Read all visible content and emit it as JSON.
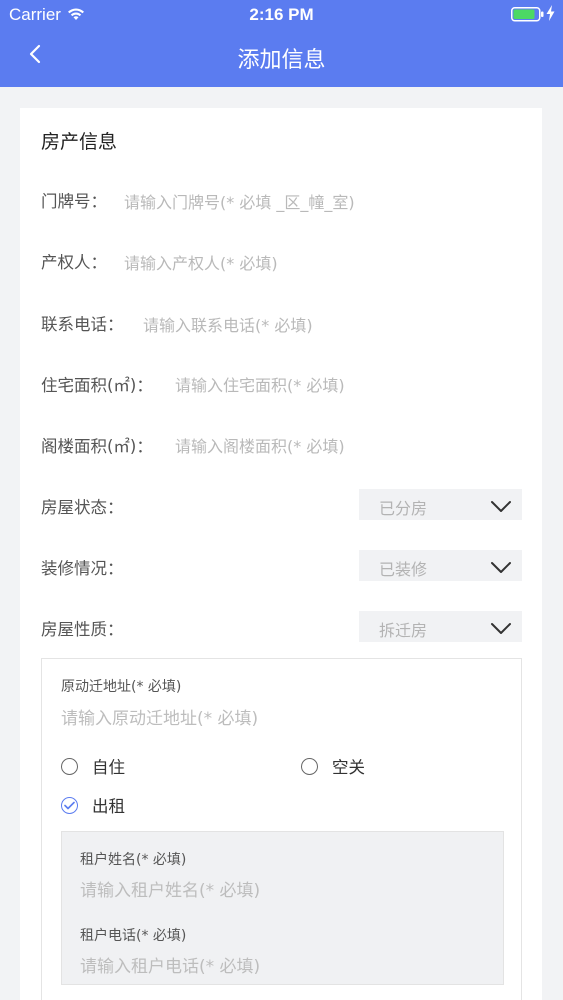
{
  "status_bar": {
    "carrier": "Carrier",
    "time": "2:16 PM"
  },
  "nav": {
    "title": "添加信息"
  },
  "section": {
    "title": "房产信息"
  },
  "fields": {
    "door_no": {
      "label": "门牌号：",
      "placeholder": "请输入门牌号(* 必填 _区_幢_室)"
    },
    "owner": {
      "label": "产权人：",
      "placeholder": "请输入产权人(* 必填)"
    },
    "phone": {
      "label": "联系电话：",
      "placeholder": "请输入联系电话(* 必填)"
    },
    "house_area": {
      "label": "住宅面积(㎡)：",
      "placeholder": "请输入住宅面积(* 必填)"
    },
    "attic_area": {
      "label": "阁楼面积(㎡)：",
      "placeholder": "请输入阁楼面积(* 必填)"
    }
  },
  "selects": {
    "house_status": {
      "label": "房屋状态：",
      "value": "已分房"
    },
    "decoration": {
      "label": "装修情况：",
      "value": "已装修"
    },
    "house_nature": {
      "label": "房屋性质：",
      "value": "拆迁房"
    }
  },
  "relocation": {
    "label": "原动迁地址(* 必填)",
    "placeholder": "请输入原动迁地址(* 必填)",
    "options": [
      {
        "label": "自住",
        "checked": false
      },
      {
        "label": "空关",
        "checked": false
      },
      {
        "label": "出租",
        "checked": true
      }
    ],
    "tenant": {
      "name_label": "租户姓名(* 必填)",
      "name_placeholder": "请输入租户姓名(* 必填)",
      "phone_label": "租户电话(* 必填)",
      "phone_placeholder": "请输入租户电话(* 必填)"
    }
  },
  "colors": {
    "accent": "#5b7cf0",
    "background": "#f2f3f5",
    "placeholder": "#b9b9b9"
  }
}
